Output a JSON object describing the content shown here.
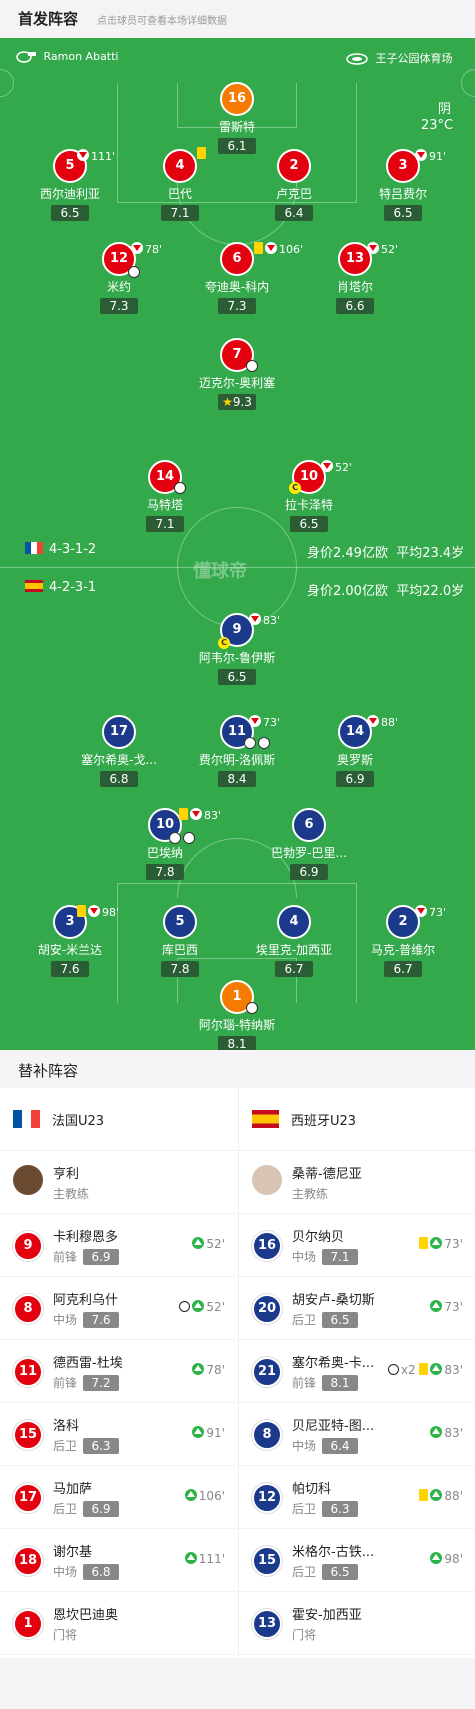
{
  "header": {
    "title": "首发阵容",
    "subtitle": "点击球员可查看本场详细数据"
  },
  "match": {
    "referee": "Ramon Abatti",
    "stadium": "王子公园体育场",
    "weather": "阴",
    "temperature": "23°C",
    "watermark": "懂球帝"
  },
  "colors": {
    "pitch": "#33a94b",
    "home": "#e3000f",
    "away": "#1b3a8c",
    "gk": "#f57c00"
  },
  "home": {
    "formation": "4-3-1-2",
    "value": "身价2.49亿欧",
    "age": "平均23.4岁",
    "players": {
      "gk": {
        "num": "16",
        "name": "雷斯特",
        "rating": "6.1"
      },
      "d1": {
        "num": "5",
        "name": "西尔迪利亚",
        "rating": "6.5",
        "ev": "111'"
      },
      "d2": {
        "num": "4",
        "name": "巴代",
        "rating": "7.1"
      },
      "d3": {
        "num": "2",
        "name": "卢克巴",
        "rating": "6.4"
      },
      "d4": {
        "num": "3",
        "name": "特吕费尔",
        "rating": "6.5",
        "ev": "91'"
      },
      "m1": {
        "num": "12",
        "name": "米约",
        "rating": "7.3",
        "ev": "78'"
      },
      "m2": {
        "num": "6",
        "name": "夸迪奥-科内",
        "rating": "7.3",
        "ev": "106'"
      },
      "m3": {
        "num": "13",
        "name": "肖塔尔",
        "rating": "6.6",
        "ev": "52'"
      },
      "am": {
        "num": "7",
        "name": "迈克尔-奥利塞",
        "rating": "9.3"
      },
      "f1": {
        "num": "14",
        "name": "马特塔",
        "rating": "7.1"
      },
      "f2": {
        "num": "10",
        "name": "拉卡泽特",
        "rating": "6.5",
        "ev": "52'"
      }
    }
  },
  "away": {
    "formation": "4-2-3-1",
    "value": "身价2.00亿欧",
    "age": "平均22.0岁",
    "players": {
      "st": {
        "num": "9",
        "name": "阿韦尔-鲁伊斯",
        "rating": "6.5",
        "ev": "83'"
      },
      "a1": {
        "num": "17",
        "name": "塞尔希奥-戈...",
        "rating": "6.8"
      },
      "a2": {
        "num": "11",
        "name": "费尔明-洛佩斯",
        "rating": "8.4",
        "ev": "73'"
      },
      "a3": {
        "num": "14",
        "name": "奥罗斯",
        "rating": "6.9",
        "ev": "88'"
      },
      "c1": {
        "num": "10",
        "name": "巴埃纳",
        "rating": "7.8",
        "ev": "83'"
      },
      "c2": {
        "num": "6",
        "name": "巴勃罗-巴里...",
        "rating": "6.9"
      },
      "d1": {
        "num": "3",
        "name": "胡安-米兰达",
        "rating": "7.6",
        "ev": "98'"
      },
      "d2": {
        "num": "5",
        "name": "库巴西",
        "rating": "7.8"
      },
      "d3": {
        "num": "4",
        "name": "埃里克-加西亚",
        "rating": "6.7"
      },
      "d4": {
        "num": "2",
        "name": "马克-普维尔",
        "rating": "6.7",
        "ev": "73'"
      },
      "gk": {
        "num": "1",
        "name": "阿尔瑙-特纳斯",
        "rating": "8.1"
      }
    }
  },
  "bench_title": "替补阵容",
  "bench": {
    "home_team": "法国U23",
    "away_team": "西班牙U23",
    "home": [
      {
        "num": "",
        "name": "亨利",
        "pos": "主教练",
        "rating": "",
        "ev": ""
      },
      {
        "num": "9",
        "name": "卡利穆恩多",
        "pos": "前锋",
        "rating": "6.9",
        "ev": "52'"
      },
      {
        "num": "8",
        "name": "阿克利乌什",
        "pos": "中场",
        "rating": "7.6",
        "ev": "52'"
      },
      {
        "num": "11",
        "name": "德西雷-杜埃",
        "pos": "前锋",
        "rating": "7.2",
        "ev": "78'"
      },
      {
        "num": "15",
        "name": "洛科",
        "pos": "后卫",
        "rating": "6.3",
        "ev": "91'"
      },
      {
        "num": "17",
        "name": "马加萨",
        "pos": "后卫",
        "rating": "6.9",
        "ev": "106'"
      },
      {
        "num": "18",
        "name": "谢尔基",
        "pos": "中场",
        "rating": "6.8",
        "ev": "111'"
      },
      {
        "num": "1",
        "name": "恩坎巴迪奥",
        "pos": "门将",
        "rating": "",
        "ev": ""
      }
    ],
    "away": [
      {
        "num": "",
        "name": "桑蒂-德尼亚",
        "pos": "主教练",
        "rating": "",
        "ev": ""
      },
      {
        "num": "16",
        "name": "贝尔纳贝",
        "pos": "中场",
        "rating": "7.1",
        "ev": "73'"
      },
      {
        "num": "20",
        "name": "胡安卢-桑切斯",
        "pos": "后卫",
        "rating": "6.5",
        "ev": "73'"
      },
      {
        "num": "21",
        "name": "塞尔希奥-卡...",
        "pos": "前锋",
        "rating": "8.1",
        "ev": "83'",
        "goals": "x2"
      },
      {
        "num": "8",
        "name": "贝尼亚特-图...",
        "pos": "中场",
        "rating": "6.4",
        "ev": "83'"
      },
      {
        "num": "12",
        "name": "帕切科",
        "pos": "后卫",
        "rating": "6.3",
        "ev": "88'"
      },
      {
        "num": "15",
        "name": "米格尔-古铁...",
        "pos": "后卫",
        "rating": "6.5",
        "ev": "98'"
      },
      {
        "num": "13",
        "name": "霍安-加西亚",
        "pos": "门将",
        "rating": "",
        "ev": ""
      }
    ]
  }
}
